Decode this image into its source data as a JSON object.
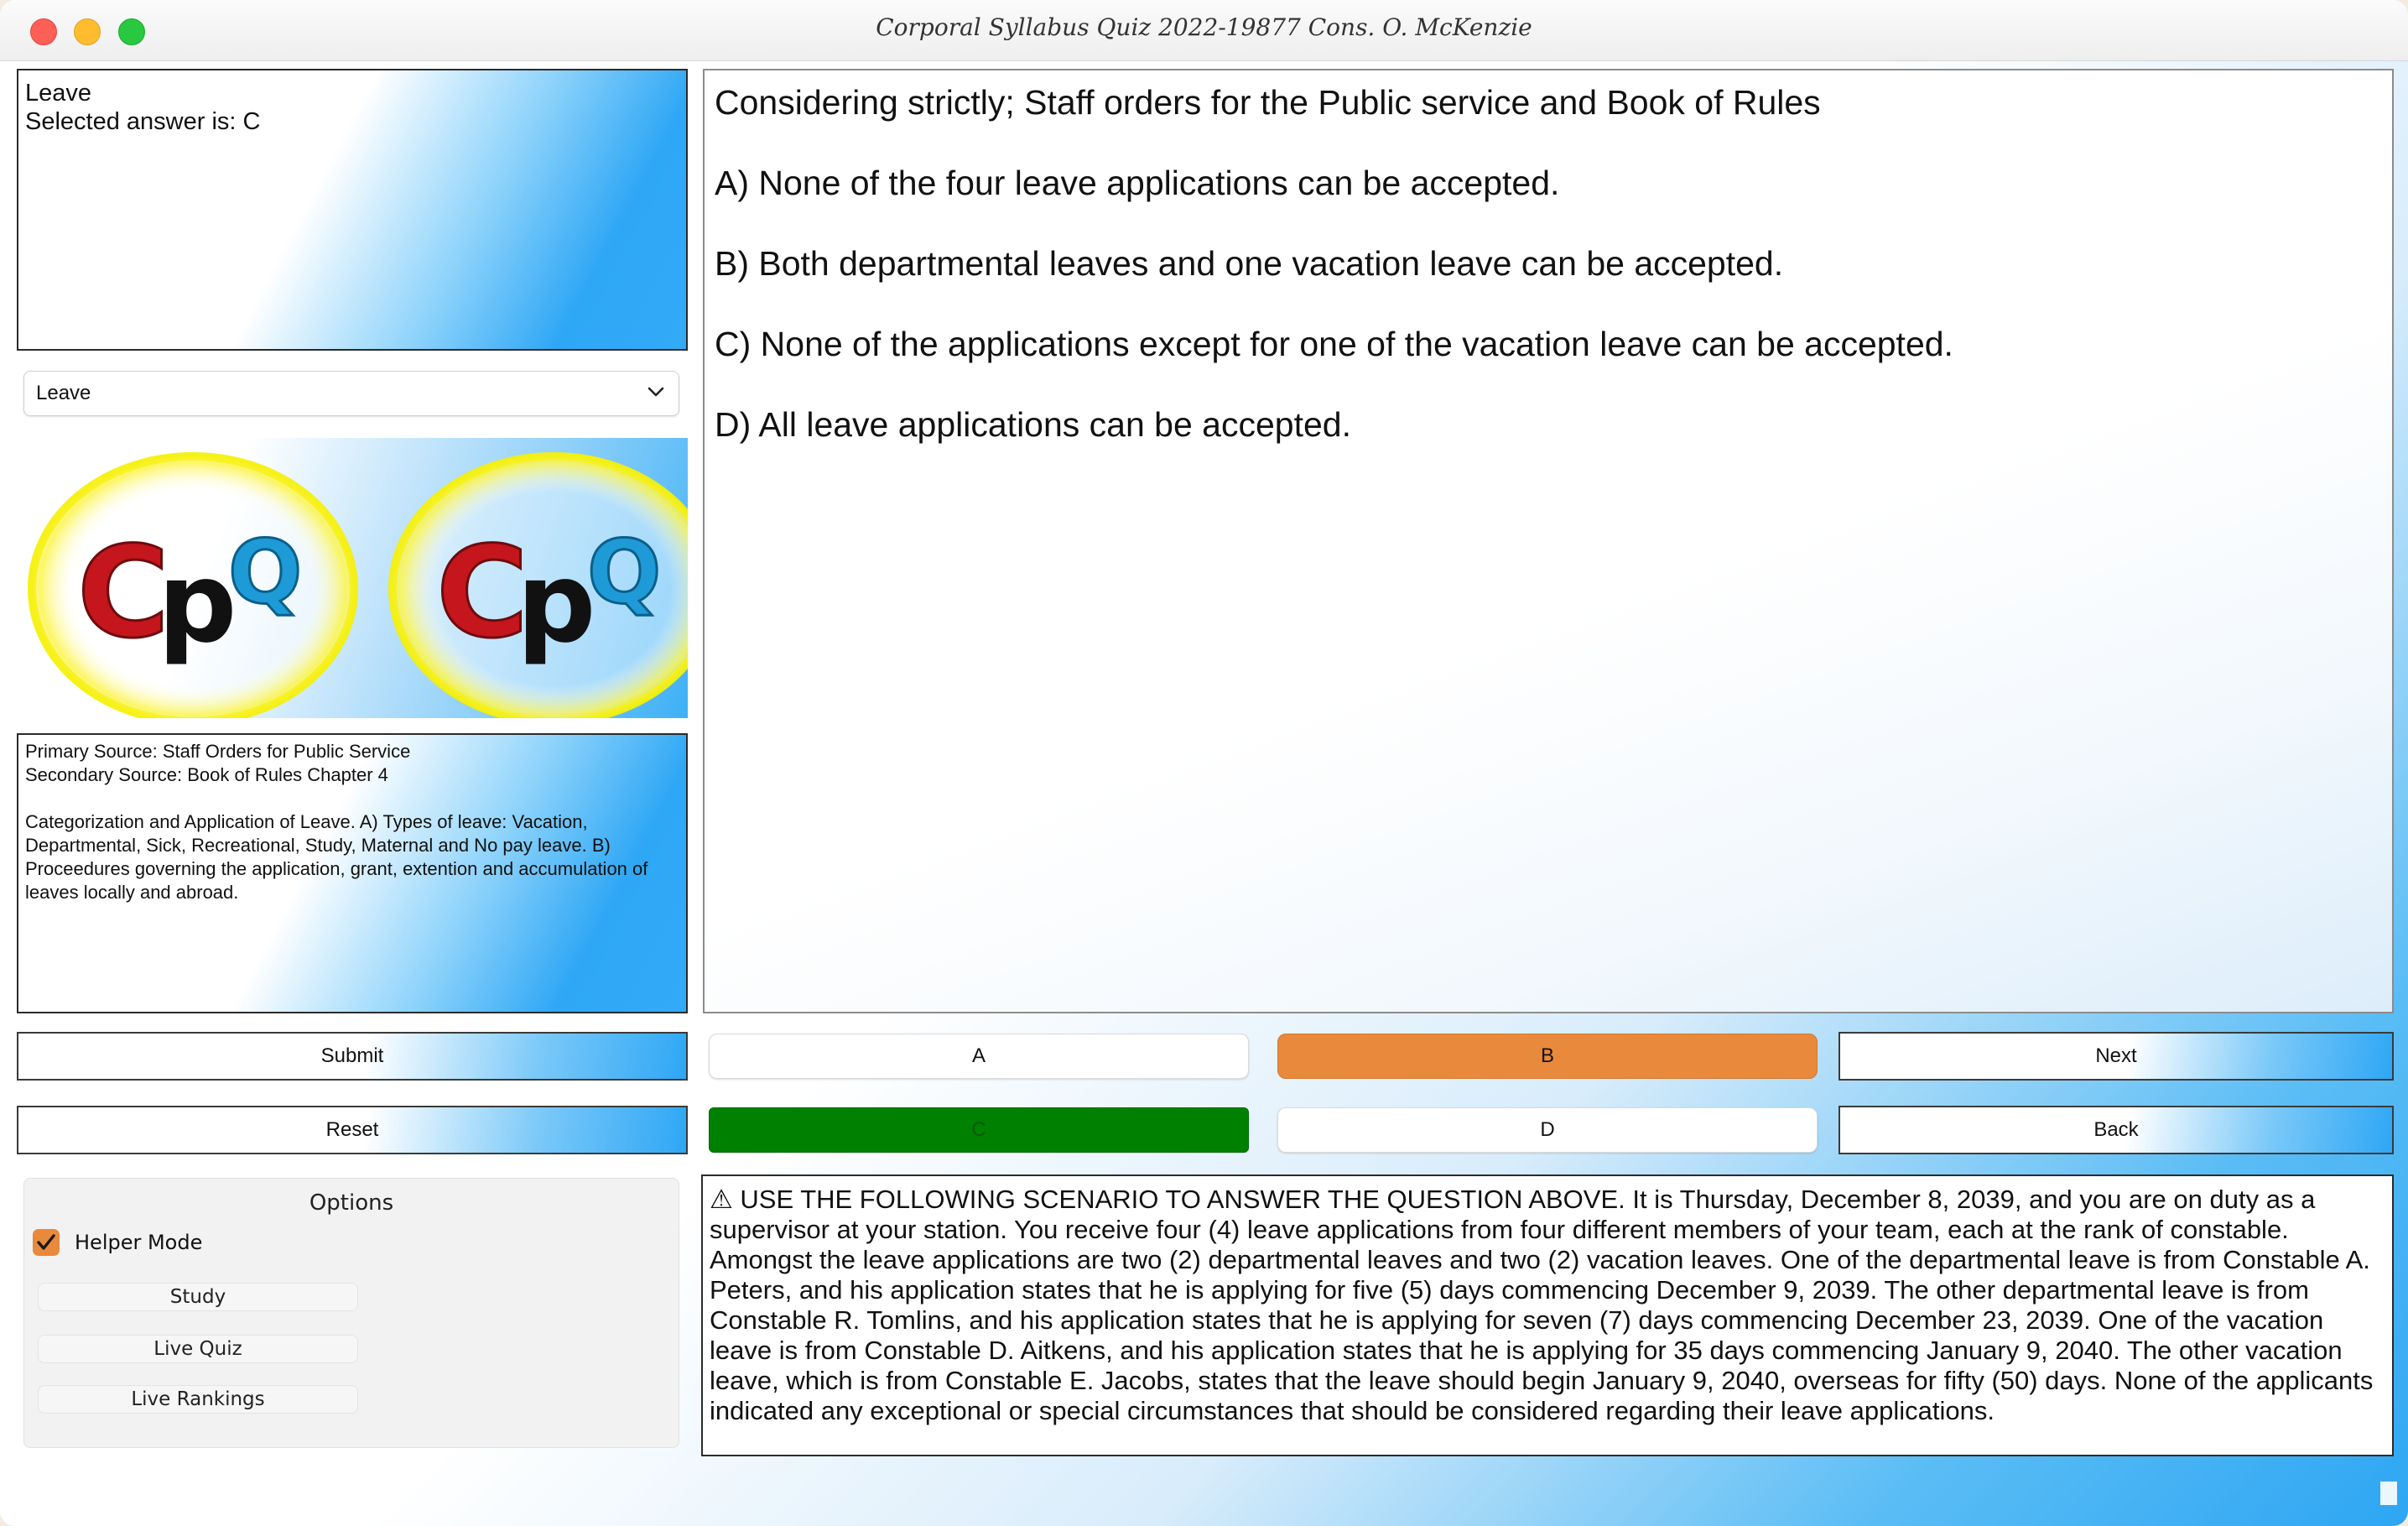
{
  "window": {
    "title": "Corporal Syllabus Quiz 2022-19877 Cons. O. McKenzie"
  },
  "status": {
    "topic": "Leave",
    "selected_answer": "Selected answer is: C"
  },
  "topic_select": {
    "value": "Leave"
  },
  "logo": {
    "text": "CpQ",
    "colors": {
      "c": "#c4161c",
      "p": "#111111",
      "q": "#1e9bd7",
      "ring": "#f5f000"
    }
  },
  "source": {
    "primary": "Primary Source: Staff Orders for Public Service",
    "secondary": "Secondary Source: Book of Rules Chapter 4",
    "description": "Categorization and Application of Leave. A) Types of leave: Vacation, Departmental, Sick, Recreational, Study, Maternal and No pay leave. B) Proceedures governing the application, grant, extention and accumulation of leaves locally and abroad."
  },
  "question": {
    "prompt": "Considering strictly; Staff orders for the Public service and Book of Rules",
    "options": [
      "A) None of the four leave applications can be accepted.",
      "B) Both departmental leaves and one vacation leave can be accepted.",
      "C) None of the applications except for one of the vacation leave can be accepted.",
      "D) All leave applications can be accepted."
    ]
  },
  "buttons": {
    "submit": "Submit",
    "reset": "Reset",
    "a": "A",
    "b": "B",
    "c": "C",
    "d": "D",
    "next": "Next",
    "back": "Back"
  },
  "colors": {
    "answer_selected": "#008000",
    "answer_highlight": "#e8893c",
    "accent_blue": "#2ea7f5"
  },
  "options_panel": {
    "title": "Options",
    "helper_mode_label": "Helper Mode",
    "helper_mode_checked": true,
    "study": "Study",
    "live_quiz": "Live Quiz",
    "live_rankings": "Live Rankings"
  },
  "scenario": {
    "icon": "warning-icon",
    "text": "⚠ USE THE FOLLOWING SCENARIO TO ANSWER THE QUESTION ABOVE. It is Thursday, December 8, 2039, and you are on duty as a supervisor at your station. You receive four (4) leave applications from four different members of your team, each at the rank of constable. Amongst the leave applications are two (2) departmental leaves and two (2) vacation leaves. One of the departmental leave is from Constable A. Peters, and his application states that he is applying for five (5) days commencing December 9, 2039. The other departmental leave is from Constable R. Tomlins, and his application states that he is applying for seven (7) days commencing December 23, 2039. One of the vacation leave is from Constable D. Aitkens, and his application states that he is applying for 35 days commencing January 9, 2040. The other vacation leave, which is from Constable E. Jacobs, states that the leave should begin January 9, 2040, overseas for fifty (50) days. None of the applicants indicated any exceptional or special circumstances that should be considered regarding their leave applications."
  }
}
